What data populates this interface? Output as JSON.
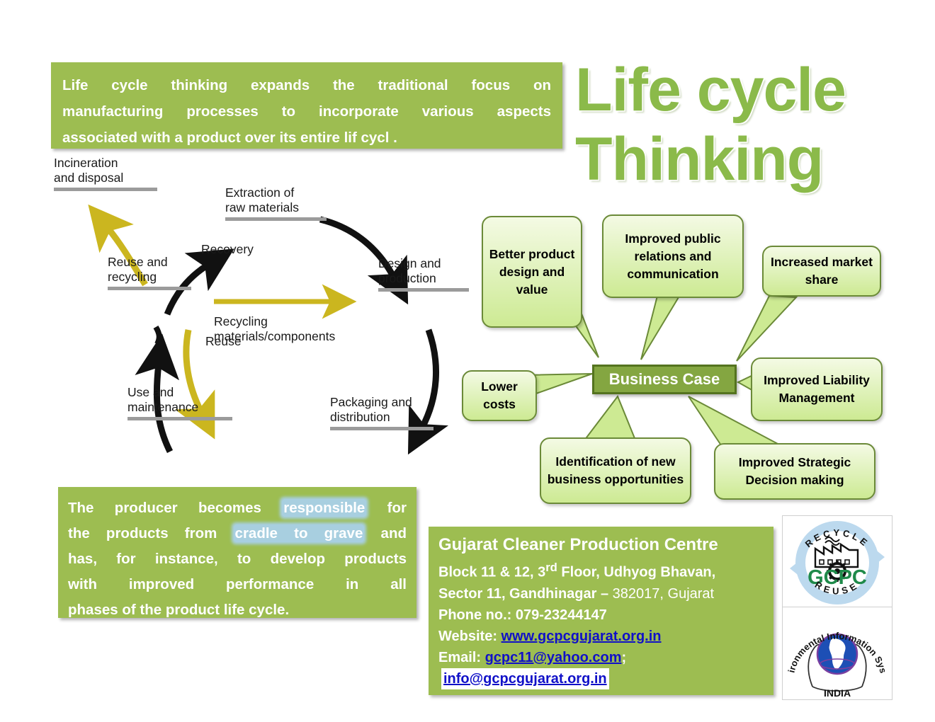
{
  "title": {
    "line1": "Life cycle",
    "line2": "Thinking",
    "color": "#8bba4a"
  },
  "intro": {
    "line1": "Life cycle thinking expands the traditional focus on",
    "line2": "manufacturing processes to incorporate various aspects",
    "line3": "associated with a product over its entire lif  cycl  ."
  },
  "producer": {
    "l1a": "The producer becomes ",
    "l1b": "responsible",
    "l1c": " for",
    "l2a": "the products from ",
    "l2b": "cradle to grave",
    "l2c": " and",
    "l3": "has, for instance, to develop products",
    "l4": "with improved performance in all",
    "l5": "phases of the product life cycle.",
    "highlight_color": "#a8cfe0"
  },
  "wheel": {
    "stages": [
      {
        "id": "incineration",
        "line1": "Incineration",
        "line2": "and disposal"
      },
      {
        "id": "extraction",
        "line1": "Extraction of",
        "line2": "raw materials"
      },
      {
        "id": "design",
        "line1": "Design and",
        "line2": "production"
      },
      {
        "id": "packaging",
        "line1": "Packaging and",
        "line2": "distribution"
      },
      {
        "id": "use",
        "line1": "Use and",
        "line2": "maintenance"
      },
      {
        "id": "reuse-recycling",
        "line1": "Reuse and",
        "line2": "recycling"
      }
    ],
    "flows": [
      {
        "id": "recovery",
        "label": "Recovery"
      },
      {
        "id": "recycling-materials",
        "line1": "Recycling",
        "line2": "materials/components"
      },
      {
        "id": "reuse",
        "label": "Reuse"
      }
    ],
    "arrow_black": "#111111",
    "arrow_yellow": "#cbb61f",
    "underline_color": "#9b9b9b"
  },
  "business": {
    "center_label": "Business Case",
    "center_fill": "#84a641",
    "center_border": "#54731f",
    "bubbles": [
      {
        "id": "better-product",
        "text": "Better product design and value"
      },
      {
        "id": "improved-public-relations",
        "text": "Improved public relations and communication"
      },
      {
        "id": "increased-market-share",
        "text": "Increased market share"
      },
      {
        "id": "lower-costs",
        "text": "Lower costs"
      },
      {
        "id": "improved-liability",
        "text": "Improved Liability Management"
      },
      {
        "id": "identification-new-business",
        "text": "Identification of new business opportunities"
      },
      {
        "id": "improved-strategic-decision",
        "text": "Improved Strategic Decision making"
      }
    ]
  },
  "contact": {
    "org": "Gujarat Cleaner Production Centre",
    "addr1_a": "Block 11 & 12, 3",
    "addr1_sup": "rd",
    "addr1_b": " Floor, Udhyog Bhavan,",
    "addr2_a": "Sector 11, Gandhinagar – ",
    "addr2_b": "382017, Gujarat",
    "phone_label": "Phone no.: ",
    "phone": "079-23244147",
    "website_label": "Website: ",
    "website": "www.gcpcgujarat.org.in",
    "email_label": "Email: ",
    "email1": "gcpc11@yahoo.com",
    "email_sep": ";",
    "email2": "info@gcpcgujarat.org.in"
  },
  "logos": {
    "gcpc": {
      "top_text": "RECYCLE",
      "bottom_text": "REUSE",
      "center_text": "GCPC",
      "ring_color": "#bcd9ee",
      "text_color": "#1f8a4a"
    },
    "envis": {
      "arc_text": "Environmental Information System",
      "country": "INDIA"
    }
  }
}
